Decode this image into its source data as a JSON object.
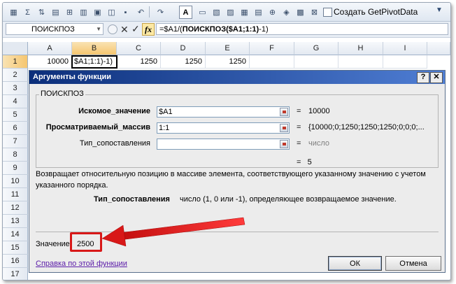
{
  "toolbar": {
    "getpivot_label": "Создать GetPivotData",
    "a_button": "A"
  },
  "formula_bar": {
    "name_box": "ПОИСКПОЗ",
    "fx": "fx",
    "formula_prefix": "=$A1/(",
    "formula_bold": "ПОИСКПОЗ($A1;1:1)",
    "formula_suffix": "-1)"
  },
  "sheet": {
    "columns": [
      "A",
      "B",
      "C",
      "D",
      "E",
      "F",
      "G",
      "H",
      "I"
    ],
    "rows": [
      "1",
      "2",
      "3",
      "4",
      "5",
      "6",
      "7",
      "8",
      "9",
      "10",
      "11",
      "12",
      "13",
      "14",
      "15",
      "16",
      "17"
    ],
    "row1": {
      "A": "10000",
      "B": "$A1;1:1)-1)",
      "C": "1250",
      "D": "1250",
      "E": "1250"
    }
  },
  "dialog": {
    "title": "Аргументы функции",
    "help_btn": "?",
    "close_btn": "✕",
    "function_name": "ПОИСКПОЗ",
    "args": [
      {
        "label": "Искомое_значение",
        "value": "$A1",
        "result": "10000"
      },
      {
        "label": "Просматриваемый_массив",
        "value": "1:1",
        "result": "{10000;0;1250;1250;1250;0;0;0;..."
      },
      {
        "label": "Тип_сопоставления",
        "value": "",
        "result": "число"
      }
    ],
    "eq": "=",
    "result": "5",
    "description": "Возвращает относительную позицию в массиве элемента, соответствующего указанному значению с учетом указанного порядка.",
    "arg_desc_name": "Тип_сопоставления",
    "arg_desc_text": "число (1, 0 или -1), определяющее возвращаемое значение.",
    "value_label": "Значение:",
    "value": "2500",
    "help_link": "Справка по этой функции",
    "ok": "ОК",
    "cancel": "Отмена"
  },
  "colors": {
    "annotation": "#d81818",
    "title_bar_start": "#0b2e7a",
    "title_bar_end": "#4f7ed4"
  }
}
